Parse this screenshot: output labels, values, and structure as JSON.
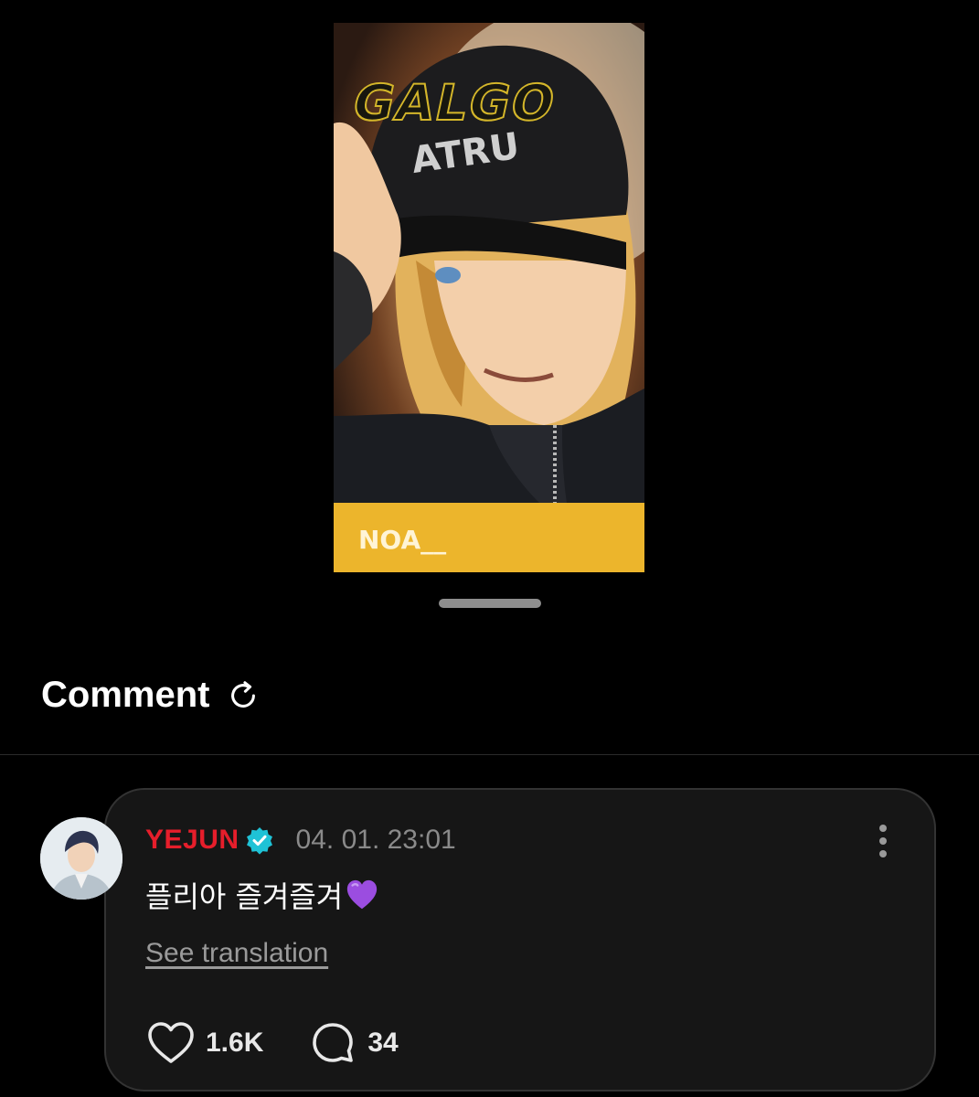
{
  "media": {
    "title_art": "GALGO",
    "hat_text": "ATRU",
    "banner_text": "NOA__"
  },
  "comments_section": {
    "title": "Comment"
  },
  "comment": {
    "username": "YEJUN",
    "timestamp": "04. 01. 23:01",
    "text": "플리아 즐겨즐겨",
    "see_translation": "See translation",
    "likes": "1.6K",
    "replies": "34"
  },
  "colors": {
    "background": "#000000",
    "username": "#e61e2b",
    "verified": "#1fc2d6",
    "card": "#161616",
    "banner": "#ecb52c"
  },
  "icons": [
    "refresh-icon",
    "verified-badge-icon",
    "more-vertical-icon",
    "purple-heart-icon",
    "heart-icon",
    "comment-bubble-icon"
  ]
}
